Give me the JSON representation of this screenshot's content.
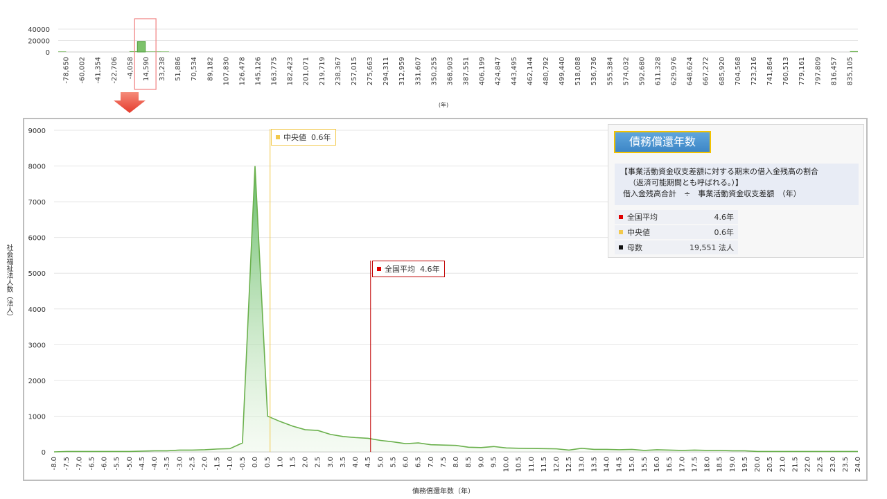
{
  "overview": {
    "y_ticks": [
      "40000",
      "20000",
      "0"
    ],
    "ymax": 40000,
    "x_labels": [
      "-78,650",
      "-60,002",
      "-41,354",
      "-22,706",
      "-4,058",
      "14,590",
      "33,238",
      "51,886",
      "70,534",
      "89,182",
      "107,830",
      "126,478",
      "145,126",
      "163,775",
      "182,423",
      "201,071",
      "219,719",
      "238,367",
      "257,015",
      "275,663",
      "294,311",
      "312,959",
      "331,607",
      "350,255",
      "368,903",
      "387,551",
      "406,199",
      "424,847",
      "443,495",
      "462,144",
      "480,792",
      "499,440",
      "518,088",
      "536,736",
      "555,384",
      "574,032",
      "592,680",
      "611,328",
      "629,976",
      "648,624",
      "667,272",
      "685,920",
      "704,568",
      "723,216",
      "741,864",
      "760,513",
      "779,161",
      "797,809",
      "816,457",
      "835,105"
    ],
    "x_values": [
      900,
      0,
      0,
      0,
      0,
      0,
      0,
      0,
      0,
      1300,
      18500,
      900,
      900,
      800,
      0,
      0,
      0,
      0,
      0,
      0,
      0,
      0,
      0,
      0,
      0,
      0,
      0,
      0,
      0,
      0,
      0,
      0,
      0,
      0,
      0,
      0,
      0,
      0,
      0,
      0,
      0,
      0,
      0,
      0,
      0,
      0,
      0,
      0,
      0,
      0,
      0,
      0,
      0,
      0,
      0,
      0,
      0,
      0,
      0,
      0,
      0,
      0,
      0,
      0,
      0,
      0,
      0,
      0,
      0,
      0,
      0,
      0,
      0,
      0,
      0,
      0,
      0,
      0,
      0,
      0,
      0,
      0,
      0,
      0,
      0,
      0,
      0,
      0,
      0,
      0,
      0,
      0,
      0,
      0,
      0,
      0,
      0,
      0,
      0,
      0,
      1400
    ],
    "unit": "(年)"
  },
  "chart_data": {
    "type": "area",
    "xlabel": "債務償還年数（年）",
    "ylabel": "社会福祉法人数（法人）",
    "ylim": [
      0,
      9000
    ],
    "xlim": [
      -8.0,
      24.0
    ],
    "y_ticks": [
      "9000",
      "8000",
      "7000",
      "6000",
      "5000",
      "4000",
      "3000",
      "2000",
      "1000",
      "0"
    ],
    "categories": [
      "-8.0",
      "-7.5",
      "-7.0",
      "-6.5",
      "-6.0",
      "-5.5",
      "-5.0",
      "-4.5",
      "-4.0",
      "-3.5",
      "-3.0",
      "-2.5",
      "-2.0",
      "-1.5",
      "-1.0",
      "-0.5",
      "0.0",
      "0.5",
      "1.0",
      "1.5",
      "2.0",
      "2.5",
      "3.0",
      "3.5",
      "4.0",
      "4.5",
      "5.0",
      "5.5",
      "6.0",
      "6.5",
      "7.0",
      "7.5",
      "8.0",
      "8.5",
      "9.0",
      "9.5",
      "10.0",
      "10.5",
      "11.0",
      "11.5",
      "12.0",
      "12.5",
      "13.0",
      "13.5",
      "14.0",
      "14.5",
      "15.0",
      "15.5",
      "16.0",
      "16.5",
      "17.0",
      "17.5",
      "18.0",
      "18.5",
      "19.0",
      "19.5",
      "20.0",
      "20.5",
      "21.0",
      "21.5",
      "22.0",
      "22.5",
      "23.0",
      "23.5",
      "24.0"
    ],
    "values": [
      0,
      10,
      10,
      10,
      10,
      10,
      10,
      20,
      30,
      30,
      50,
      50,
      60,
      80,
      90,
      250,
      8000,
      1000,
      850,
      720,
      620,
      600,
      490,
      430,
      400,
      380,
      320,
      280,
      230,
      250,
      200,
      190,
      180,
      130,
      120,
      150,
      110,
      100,
      95,
      90,
      85,
      50,
      100,
      70,
      70,
      60,
      70,
      40,
      60,
      50,
      40,
      50,
      40,
      40,
      30,
      30,
      10,
      10,
      10,
      10,
      10,
      10,
      10,
      10,
      10
    ]
  },
  "annotations": {
    "median": {
      "label": "中央値",
      "value": "0.6年",
      "x": 0.6,
      "color": "#f2c94c"
    },
    "average": {
      "label": "全国平均",
      "value": "4.6年",
      "x": 4.6,
      "color": "#c00000"
    }
  },
  "info": {
    "title": "債務償還年数",
    "def_line1": "【事業活動資金収支差額に対する期末の借入金残高の割合",
    "def_line2": "（返済可能期間とも呼ばれる。）】",
    "def_line3": "借入金残高合計　÷　事業活動資金収支差額　（年）",
    "rows": [
      {
        "label": "全国平均",
        "value": "4.6年",
        "color": "#e00000"
      },
      {
        "label": "中央値",
        "value": "0.6年",
        "color": "#f2c94c"
      },
      {
        "label": "母数",
        "value": "19,551 法人",
        "color": "#111111"
      }
    ]
  },
  "colors": {
    "series": "#6ab04c",
    "grid": "#e4e4e4",
    "highlight": "#f08080"
  }
}
